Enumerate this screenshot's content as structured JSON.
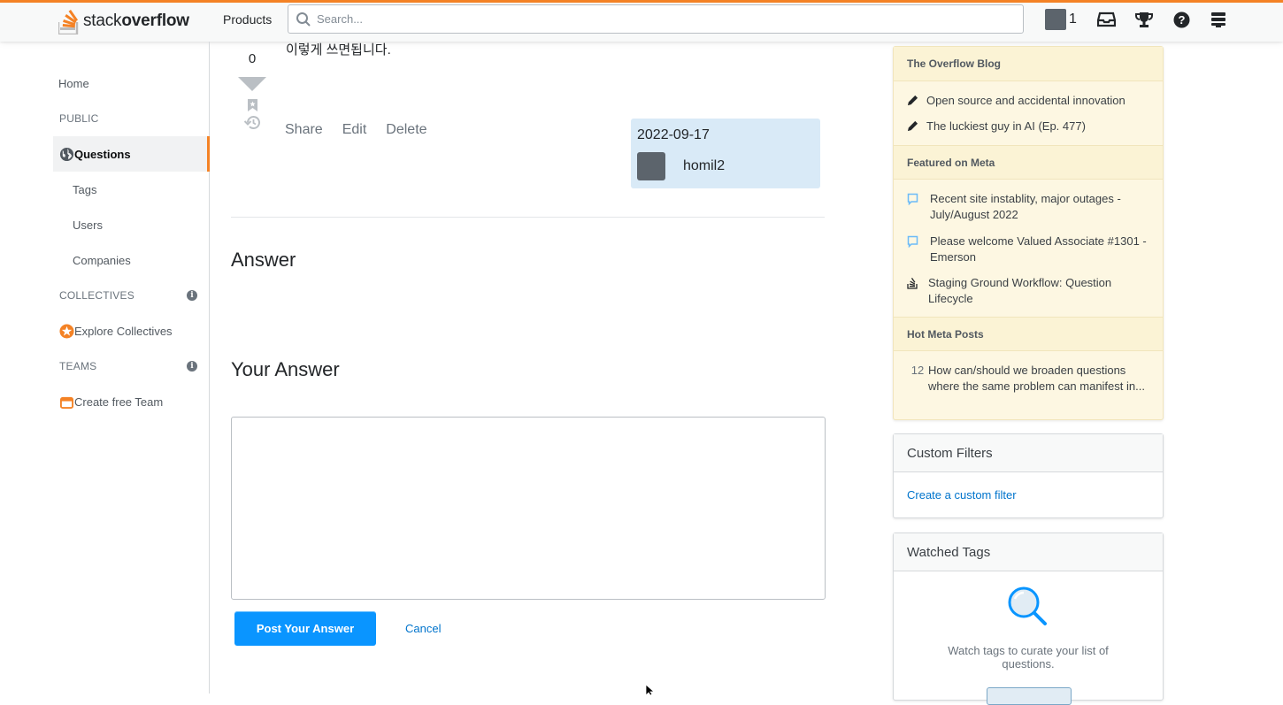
{
  "topbar": {
    "logo_light": "stack",
    "logo_bold": "overflow",
    "products_label": "Products",
    "search_placeholder": "Search...",
    "reputation": "1"
  },
  "leftnav": {
    "home": "Home",
    "public": "PUBLIC",
    "questions": "Questions",
    "tags": "Tags",
    "users": "Users",
    "companies": "Companies",
    "collectives": "COLLECTIVES",
    "explore_collectives": "Explore Collectives",
    "teams": "TEAMS",
    "create_team": "Create free Team"
  },
  "post": {
    "vote_count": "0",
    "body": "이렇게 쓰면됩니다.",
    "menu": {
      "share": "Share",
      "edit": "Edit",
      "delete": "Delete"
    },
    "owner": {
      "date": "2022-09-17",
      "name": "homil2"
    }
  },
  "answers": {
    "heading": "Answer",
    "your_answer_heading": "Your Answer",
    "post_button": "Post Your Answer",
    "cancel": "Cancel"
  },
  "sidebar": {
    "blog": {
      "heading": "The Overflow Blog",
      "items": [
        "Open source and accidental innovation",
        "The luckiest guy in AI (Ep. 477)"
      ]
    },
    "featured": {
      "heading": "Featured on Meta",
      "items": [
        "Recent site instablity, major outages - July/August 2022",
        "Please welcome Valued Associate #1301 - Emerson",
        "Staging Ground Workflow: Question Lifecycle"
      ]
    },
    "hot_meta": {
      "heading": "Hot Meta Posts",
      "items": [
        {
          "count": "12",
          "title": "How can/should we broaden questions where the same problem can manifest in..."
        }
      ]
    },
    "custom_filters": {
      "heading": "Custom Filters",
      "link": "Create a custom filter"
    },
    "watched_tags": {
      "heading": "Watched Tags",
      "text": "Watch tags to curate your list of questions."
    }
  },
  "colors": {
    "accent": "#f48225",
    "primary_button": "#0a95ff",
    "link": "#0074cc",
    "owner_card": "#d9eaf7",
    "blog_bg": "#fdf7e2"
  }
}
